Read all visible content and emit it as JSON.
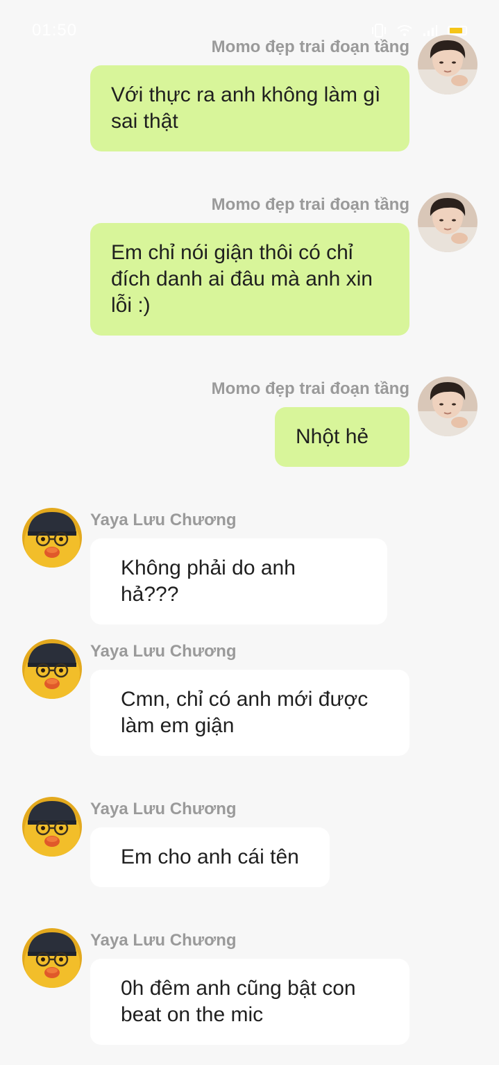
{
  "status_bar": {
    "time": "01:50",
    "icons": [
      "vibrate-icon",
      "wifi-icon",
      "signal-icon",
      "battery-icon"
    ],
    "battery_color": "#f5c518"
  },
  "colors": {
    "background": "#f7f7f7",
    "outgoing_bubble": "#d8f59a",
    "incoming_bubble": "#ffffff",
    "sender_name": "#9a9a9a"
  },
  "messages": [
    {
      "direction": "outgoing",
      "sender": "Momo đẹp trai đoạn tầng",
      "avatar": "boy-photo-avatar",
      "text": "Với thực ra anh không làm gì sai thật"
    },
    {
      "direction": "outgoing",
      "sender": "Momo đẹp trai đoạn tầng",
      "avatar": "boy-photo-avatar",
      "text": "Em chỉ nói giận thôi có chỉ đích danh ai đâu mà anh xin lỗi :)"
    },
    {
      "direction": "outgoing",
      "sender": "Momo đẹp trai đoạn tầng",
      "avatar": "boy-photo-avatar",
      "text": "Nhột hẻ"
    },
    {
      "direction": "incoming",
      "sender": "Yaya Lưu Chương",
      "avatar": "duck-with-glasses-avatar",
      "text": "Không phải do anh hả???"
    },
    {
      "direction": "incoming",
      "sender": "Yaya Lưu Chương",
      "avatar": "duck-with-glasses-avatar",
      "text": "Cmn, chỉ có anh mới được làm em giận"
    },
    {
      "direction": "incoming",
      "sender": "Yaya Lưu Chương",
      "avatar": "duck-with-glasses-avatar",
      "text": "Em cho anh cái tên"
    },
    {
      "direction": "incoming",
      "sender": "Yaya Lưu Chương",
      "avatar": "duck-with-glasses-avatar",
      "text": "0h đêm anh cũng bật con beat on the mic"
    }
  ]
}
